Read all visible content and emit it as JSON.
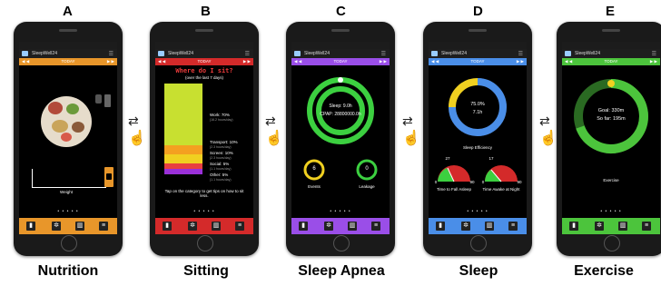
{
  "panels": [
    {
      "letter": "A",
      "caption": "Nutrition"
    },
    {
      "letter": "B",
      "caption": "Sitting"
    },
    {
      "letter": "C",
      "caption": "Sleep Apnea"
    },
    {
      "letter": "D",
      "caption": "Sleep"
    },
    {
      "letter": "E",
      "caption": "Exercise"
    }
  ],
  "app": {
    "name": "SleepWell24",
    "nav_today": "TODAY",
    "nav_prev": "◀ ◀",
    "nav_next": "▶ ▶",
    "dots": "• • • • •"
  },
  "nutrition": {
    "weight_label": "Weight",
    "accent": "#e8962a"
  },
  "sitting": {
    "title": "Where do I sit?",
    "subtitle": "(over the last 7 days)",
    "rows": [
      {
        "label": "Work: 70%",
        "sub": "(16.2 hours/day)"
      },
      {
        "label": "Transport: 10%",
        "sub": "(2.3 hours/day)"
      },
      {
        "label": "Screen: 10%",
        "sub": "(2.3 hours/day)"
      },
      {
        "label": "Social: 5%",
        "sub": "(1.1 hours/day)"
      },
      {
        "label": "Other: 5%",
        "sub": "(1.1 hours/day)"
      }
    ],
    "tip": "Tap on the category to get tips on how to sit less.",
    "accent": "#d42a2a"
  },
  "apnea": {
    "sleep": "Sleep: 9.0h",
    "cpap": "CPAP: 28800000.0h",
    "events_value": "6",
    "events_label": "Events",
    "leakage_value": "0",
    "leakage_label": "Leakage",
    "accent": "#9a4ee8"
  },
  "sleep": {
    "pct": "75.0%",
    "hours": "7.1h",
    "efficiency_label": "Sleep Efficiency",
    "fall_value": "27",
    "fall_min": "0",
    "fall_max": "90",
    "fall_label": "Time to Fall Asleep",
    "awake_value": "17",
    "awake_min": "0",
    "awake_max": "90",
    "awake_label": "Time Awake at Night",
    "accent": "#4a8ee8"
  },
  "exercise": {
    "goal": "Goal: 330m",
    "sofar": "So far: 195m",
    "label": "Exercise",
    "accent": "#4cc43c"
  },
  "swap_icon": "⇄",
  "hand_icon": "☝"
}
